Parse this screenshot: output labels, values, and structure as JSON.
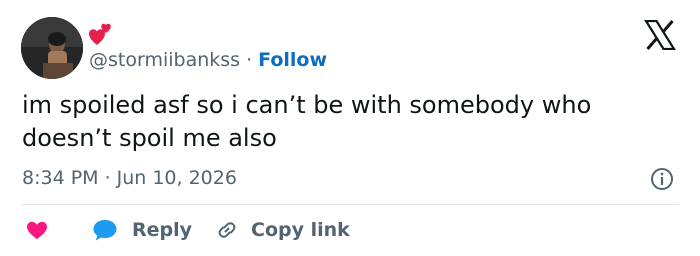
{
  "header": {
    "handle": "@stormiibankss",
    "separator": "·",
    "follow_label": "Follow"
  },
  "tweet": {
    "text": "im spoiled asf so i can’t be with somebody who doesn’t spoil me also",
    "time": "8:34 PM",
    "separator": "·",
    "date": "Jun 10, 2026"
  },
  "actions": {
    "reply_label": "Reply",
    "copy_link_label": "Copy link"
  },
  "icons": {
    "avatar": "profile-photo",
    "hearts": "two-hearts-icon",
    "logo": "x-logo-icon",
    "info": "info-icon",
    "like": "heart-icon",
    "reply": "speech-bubble-icon",
    "link": "link-icon"
  },
  "colors": {
    "follow": "#0f6dbf",
    "secondary_text": "#536471",
    "like": "#f91880",
    "reply": "#1d9bf0",
    "divider": "#dfe4e8"
  }
}
